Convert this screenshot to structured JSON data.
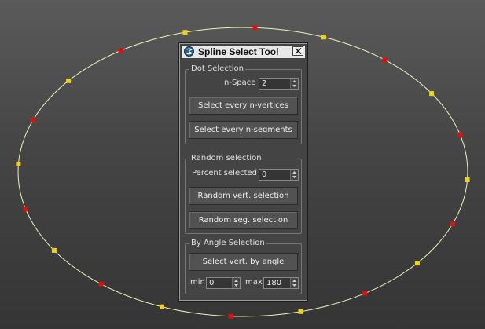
{
  "window": {
    "title": "Spline Select Tool",
    "icon": "3dsmax-logo-icon",
    "close_icon": "close-x-icon"
  },
  "dot_selection": {
    "title": "Dot Selection",
    "nspace_label": "n-Space",
    "nspace_value": "2",
    "btn_vertices": "Select every n-vertices",
    "btn_segments": "Select every n-segments"
  },
  "random_selection": {
    "title": "Random selection",
    "percent_label": "Percent selected",
    "percent_value": "0",
    "btn_vert": "Random vert. selection",
    "btn_seg": "Random seg. selection"
  },
  "angle_selection": {
    "title": "By Angle Selection",
    "btn_angle": "Select vert. by angle",
    "min_label": "min",
    "min_value": "0",
    "max_label": "max",
    "max_value": "180"
  },
  "colors": {
    "spline": "#f0f0c0",
    "vertex_yellow": "#f0d020",
    "vertex_red": "#dd1010",
    "viewport_top": "#5a5a5a",
    "viewport_bottom": "#353535",
    "panel_bg": "#444444"
  }
}
